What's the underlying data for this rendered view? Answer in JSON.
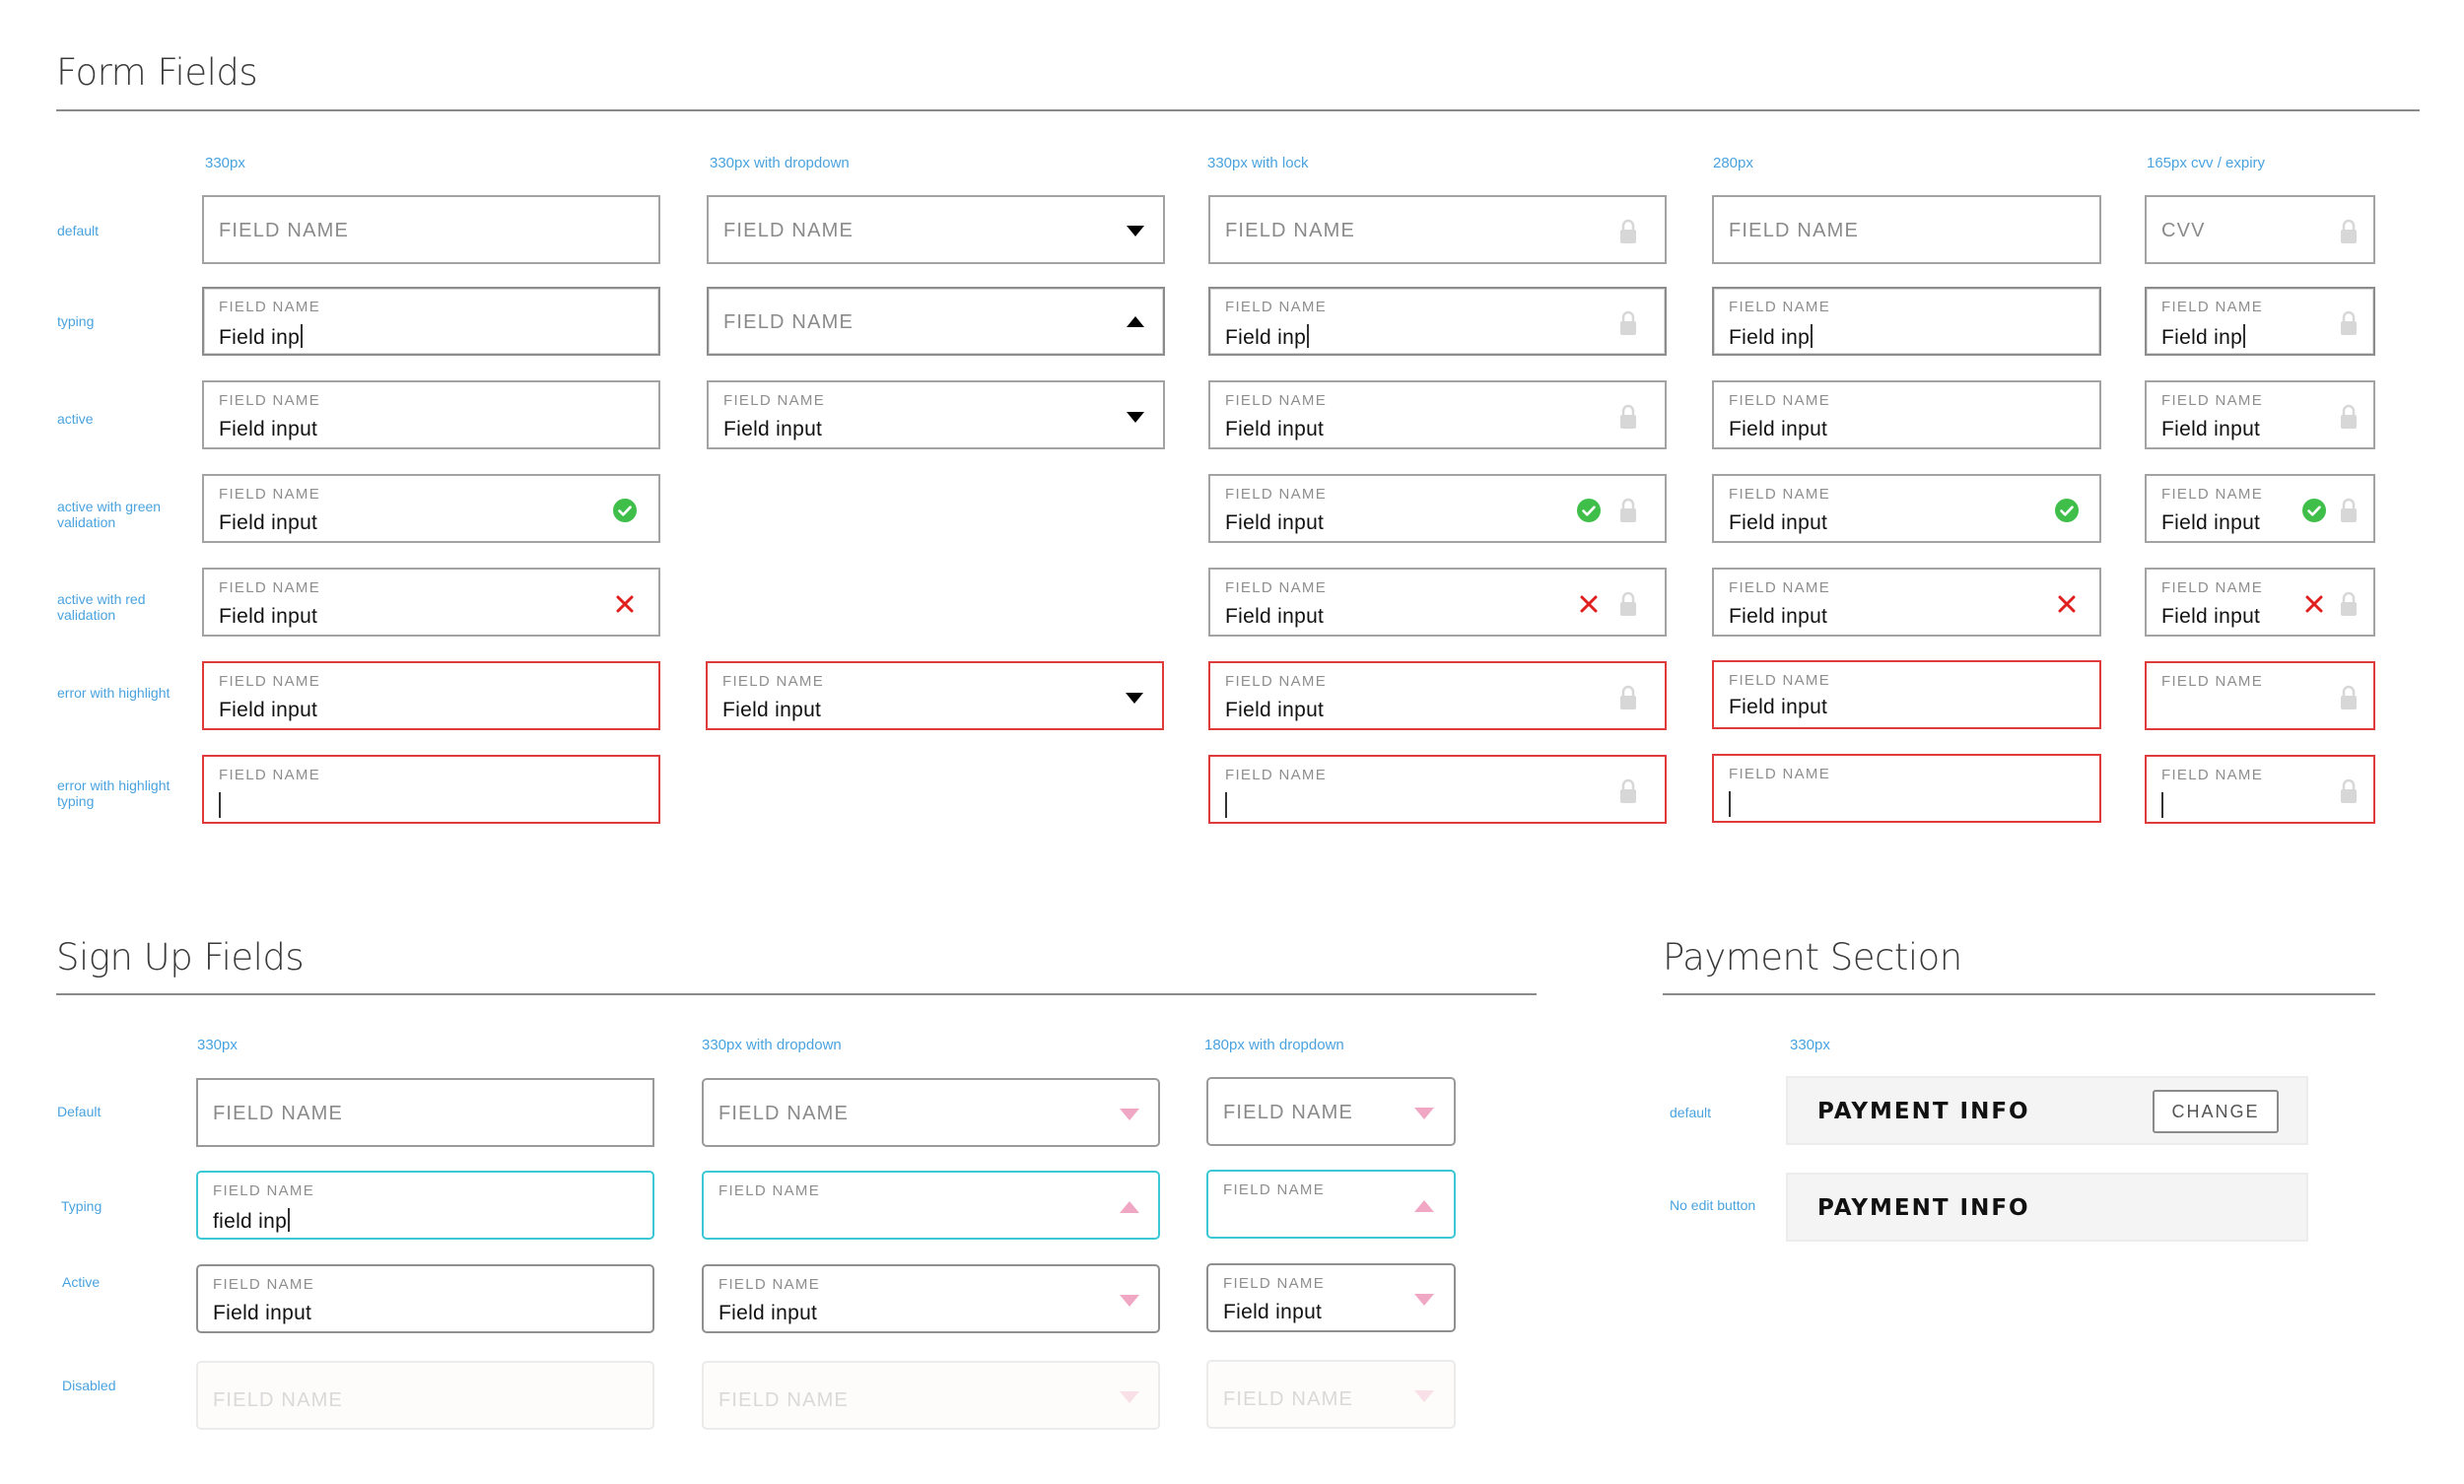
{
  "form_fields": {
    "title": "Form Fields",
    "columns": [
      "330px",
      "330px with dropdown",
      "330px with lock",
      "280px",
      "165px cvv / expiry"
    ],
    "rows": [
      "default",
      "typing",
      "active",
      "active with green validation",
      "active with red validation",
      "error with highlight",
      "error with highlight typing"
    ]
  },
  "sign_up": {
    "title": "Sign Up Fields",
    "columns": [
      "330px",
      "330px with dropdown",
      "180px with dropdown"
    ],
    "rows": [
      "Default",
      "Typing",
      "Active",
      "Disabled"
    ]
  },
  "payment": {
    "title": "Payment Section",
    "column": "330px",
    "rows": [
      "default",
      "No edit button"
    ],
    "info_label": "PAYMENT INFO",
    "change_label": "CHANGE"
  },
  "text": {
    "field_name": "FIELD NAME",
    "field_input": "Field input",
    "typing_value": "Field inp",
    "typing_value_lower": "field inp",
    "cvv": "CVV"
  },
  "colors": {
    "label_blue": "#4aa3df",
    "error_red": "#e03b3b",
    "valid_green": "#3fbf4a",
    "focus_teal": "#3cc7d6",
    "dropdown_pink": "#f0a7c3"
  }
}
